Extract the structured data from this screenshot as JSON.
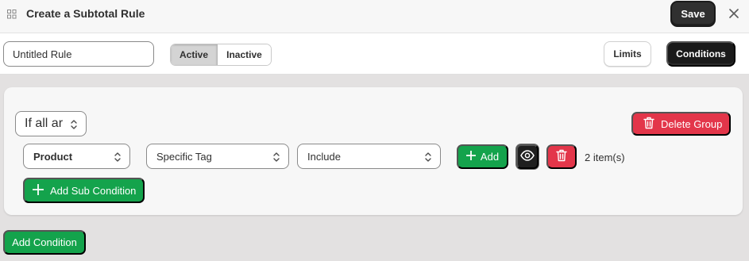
{
  "header": {
    "title": "Create a Subtotal Rule",
    "save_label": "Save"
  },
  "toolbar": {
    "rule_name_value": "Untitled Rule",
    "status_options": [
      "Active",
      "Inactive"
    ],
    "selected_status": "Active",
    "limits_label": "Limits",
    "conditions_label": "Conditions"
  },
  "group": {
    "match_select_value": "If all ar",
    "delete_group_label": "Delete Group",
    "condition": {
      "field_value": "Product",
      "type_value": "Specific Tag",
      "operator_value": "Include",
      "add_label": "Add",
      "items_count": "2 item(s)"
    },
    "add_sub_condition_label": "Add Sub Condition"
  },
  "add_condition_label": "Add Condition",
  "colors": {
    "primary_dark": "#303030",
    "success": "#14a34c",
    "critical": "#e3364a",
    "page_bg": "#e3e1e1"
  },
  "icons": [
    "app-grid-icon",
    "close-icon",
    "chevron-updown-icon",
    "trash-icon",
    "plus-icon",
    "eye-icon"
  ]
}
